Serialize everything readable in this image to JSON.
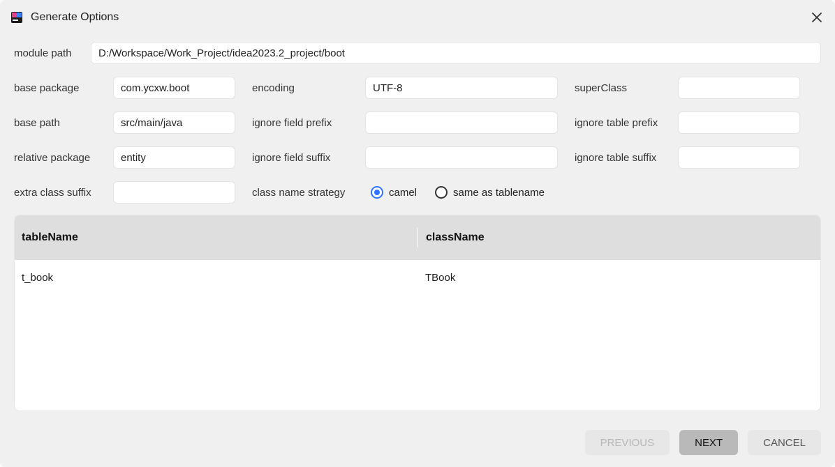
{
  "window": {
    "title": "Generate Options"
  },
  "labels": {
    "module_path": "module path",
    "base_package": "base package",
    "encoding": "encoding",
    "super_class": "superClass",
    "base_path": "base path",
    "ignore_field_prefix": "ignore field prefix",
    "ignore_table_prefix": "ignore table prefix",
    "relative_package": "relative package",
    "ignore_field_suffix": "ignore field suffix",
    "ignore_table_suffix": "ignore table suffix",
    "extra_class_suffix": "extra class suffix",
    "class_name_strategy": "class name strategy"
  },
  "fields": {
    "module_path": "D:/Workspace/Work_Project/idea2023.2_project/boot",
    "base_package": "com.ycxw.boot",
    "encoding": "UTF-8",
    "super_class": "",
    "base_path": "src/main/java",
    "ignore_field_prefix": "",
    "ignore_table_prefix": "",
    "relative_package": "entity",
    "ignore_field_suffix": "",
    "ignore_table_suffix": "",
    "extra_class_suffix": ""
  },
  "strategy": {
    "camel_label": "camel",
    "same_label": "same as tablename",
    "selected": "camel"
  },
  "table": {
    "header_table": "tableName",
    "header_class": "className",
    "rows": [
      {
        "tableName": "t_book",
        "className": "TBook"
      }
    ]
  },
  "buttons": {
    "previous": "PREVIOUS",
    "next": "NEXT",
    "cancel": "CANCEL"
  }
}
